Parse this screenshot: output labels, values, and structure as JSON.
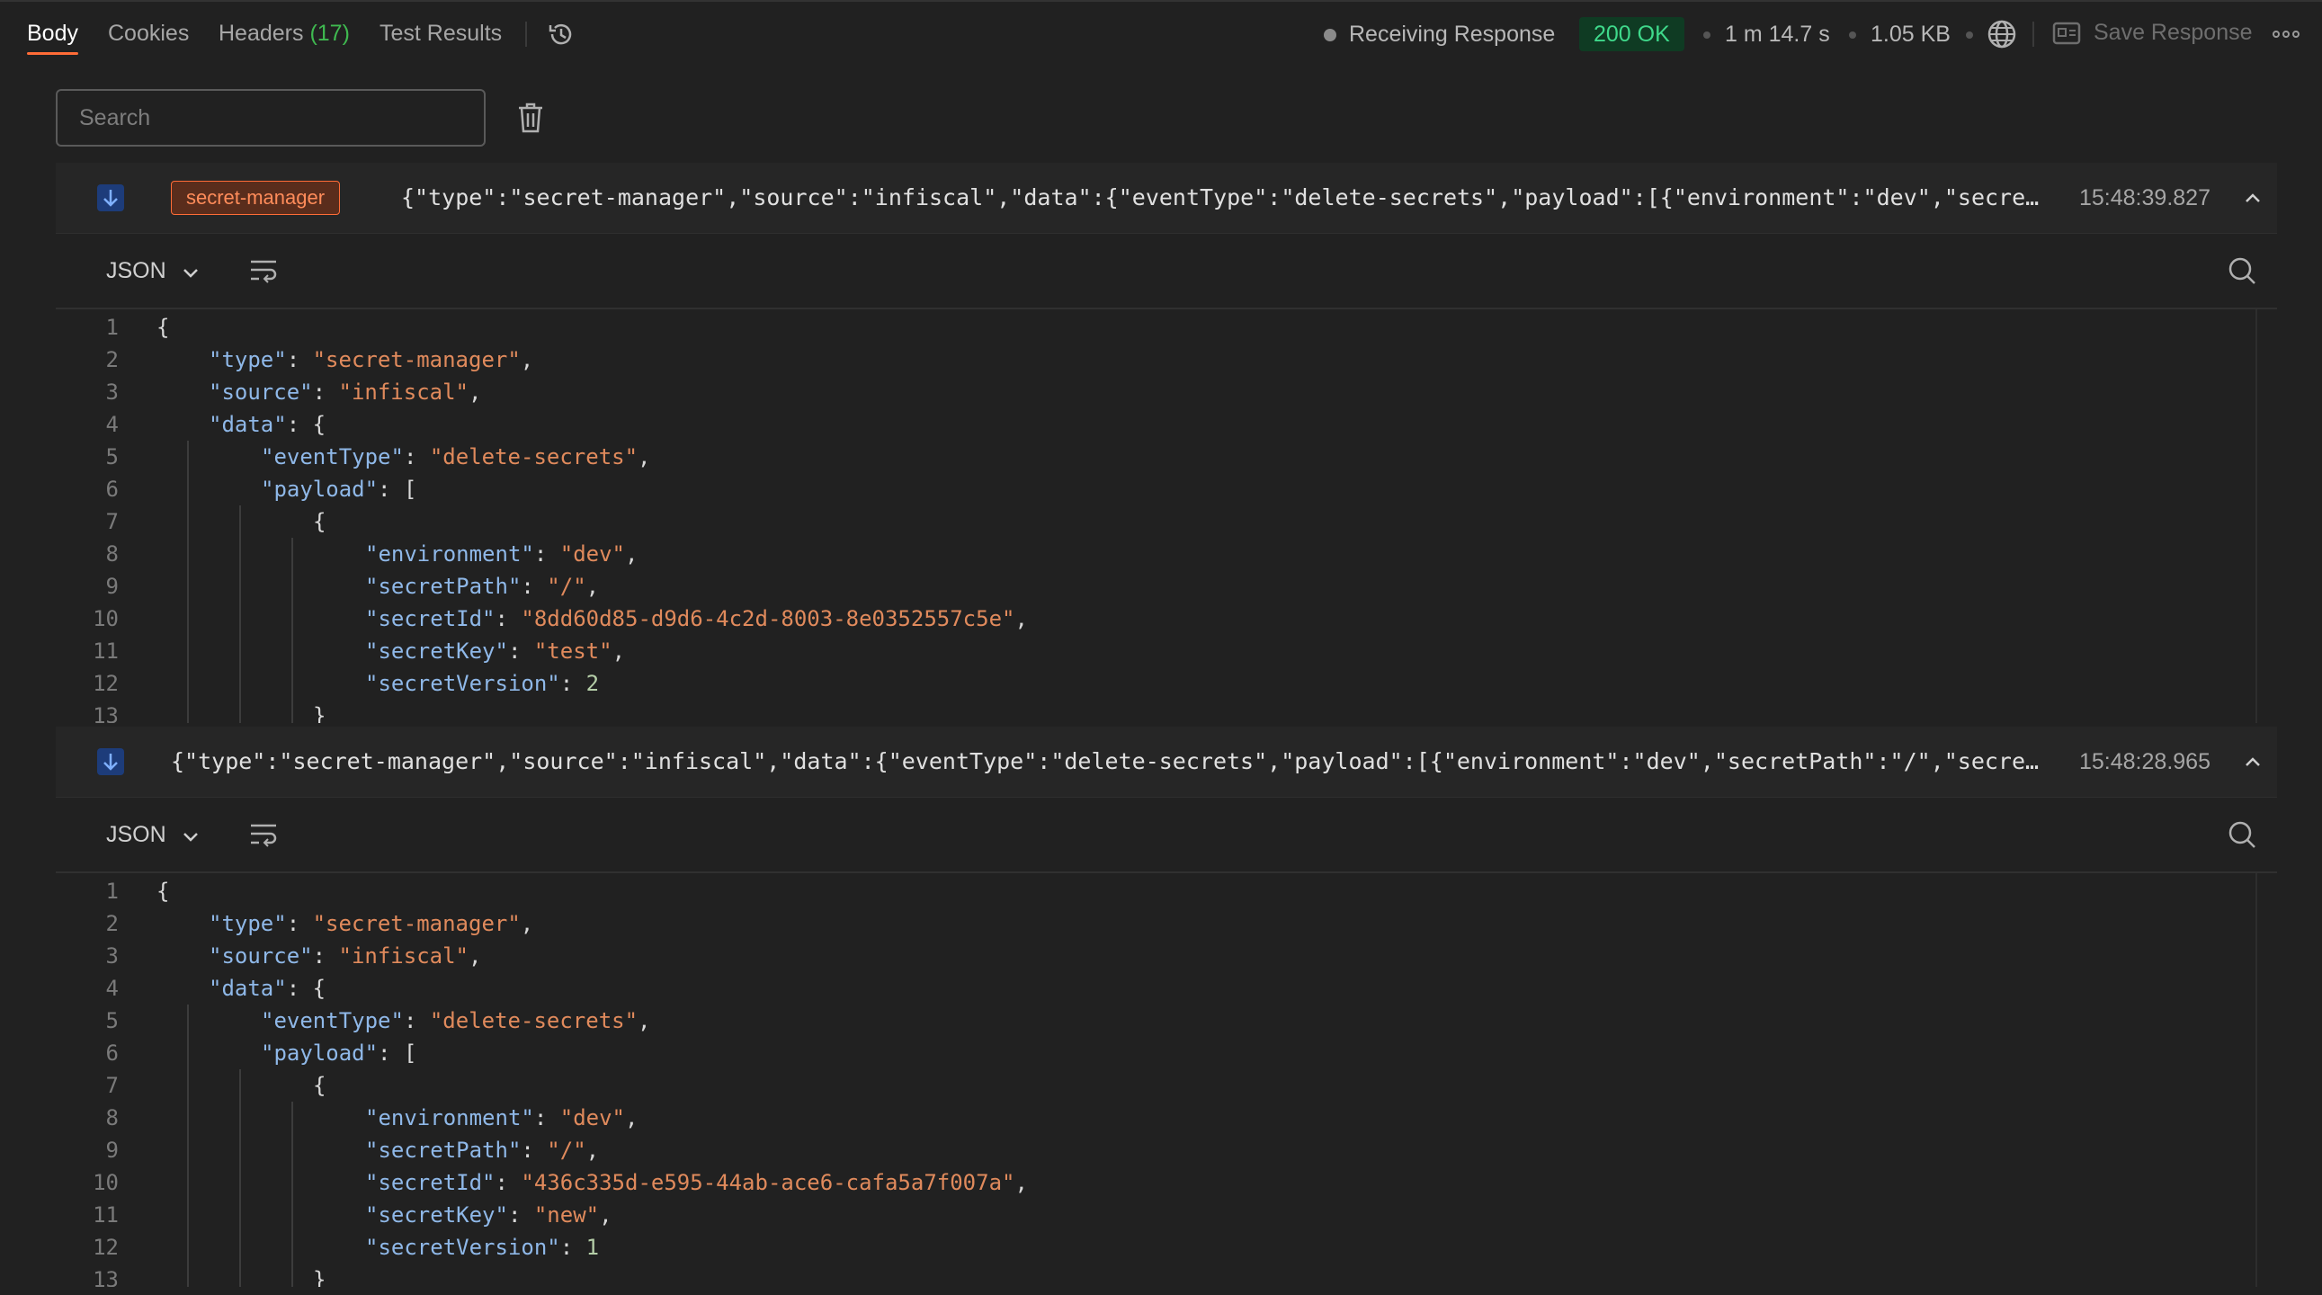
{
  "tabs": [
    {
      "label": "Body",
      "active": true
    },
    {
      "label": "Cookies"
    },
    {
      "label": "Headers",
      "count": "(17)"
    },
    {
      "label": "Test Results"
    }
  ],
  "status": {
    "receiving": "Receiving Response",
    "code": "200 OK",
    "time": "1 m 14.7 s",
    "size": "1.05 KB",
    "save_label": "Save Response"
  },
  "search": {
    "placeholder": "Search"
  },
  "messages": [
    {
      "tag": "secret-manager",
      "summary": "{\"type\":\"secret-manager\",\"source\":\"infiscal\",\"data\":{\"eventType\":\"delete-secrets\",\"payload\":[{\"environment\":\"dev\",\"secretPat…",
      "time": "15:48:39.827",
      "format": "JSON",
      "lines": [
        {
          "n": "1",
          "text": "{"
        },
        {
          "n": "2",
          "key": "\"type\"",
          "val": "\"secret-manager\"",
          "end": ","
        },
        {
          "n": "3",
          "key": "\"source\"",
          "val": "\"infiscal\"",
          "end": ","
        },
        {
          "n": "4",
          "key": "\"data\"",
          "rest": ": {"
        },
        {
          "n": "5",
          "key": "\"eventType\"",
          "val": "\"delete-secrets\"",
          "end": ","
        },
        {
          "n": "6",
          "key": "\"payload\"",
          "rest": ": ["
        },
        {
          "n": "7",
          "text": "{"
        },
        {
          "n": "8",
          "key": "\"environment\"",
          "val": "\"dev\"",
          "end": ","
        },
        {
          "n": "9",
          "key": "\"secretPath\"",
          "val": "\"/\"",
          "end": ","
        },
        {
          "n": "10",
          "key": "\"secretId\"",
          "val": "\"8dd60d85-d9d6-4c2d-8003-8e0352557c5e\"",
          "end": ","
        },
        {
          "n": "11",
          "key": "\"secretKey\"",
          "val": "\"test\"",
          "end": ","
        },
        {
          "n": "12",
          "key": "\"secretVersion\"",
          "num": "2",
          "end": ""
        },
        {
          "n": "13",
          "text": "}"
        }
      ]
    },
    {
      "tag": "",
      "summary": "{\"type\":\"secret-manager\",\"source\":\"infiscal\",\"data\":{\"eventType\":\"delete-secrets\",\"payload\":[{\"environment\":\"dev\",\"secretPath\":\"/\",\"secretId\":…",
      "time": "15:48:28.965",
      "format": "JSON",
      "lines": [
        {
          "n": "1",
          "text": "{"
        },
        {
          "n": "2",
          "key": "\"type\"",
          "val": "\"secret-manager\"",
          "end": ","
        },
        {
          "n": "3",
          "key": "\"source\"",
          "val": "\"infiscal\"",
          "end": ","
        },
        {
          "n": "4",
          "key": "\"data\"",
          "rest": ": {"
        },
        {
          "n": "5",
          "key": "\"eventType\"",
          "val": "\"delete-secrets\"",
          "end": ","
        },
        {
          "n": "6",
          "key": "\"payload\"",
          "rest": ": ["
        },
        {
          "n": "7",
          "text": "{"
        },
        {
          "n": "8",
          "key": "\"environment\"",
          "val": "\"dev\"",
          "end": ","
        },
        {
          "n": "9",
          "key": "\"secretPath\"",
          "val": "\"/\"",
          "end": ","
        },
        {
          "n": "10",
          "key": "\"secretId\"",
          "val": "\"436c335d-e595-44ab-ace6-cafa5a7f007a\"",
          "end": ","
        },
        {
          "n": "11",
          "key": "\"secretKey\"",
          "val": "\"new\"",
          "end": ","
        },
        {
          "n": "12",
          "key": "\"secretVersion\"",
          "num": "1",
          "end": ""
        },
        {
          "n": "13",
          "text": "}"
        }
      ]
    }
  ],
  "colors": {
    "accent": "#ff6c37",
    "status_ok_bg": "#0f3b23",
    "status_ok_text": "#3fd98b",
    "json_key": "#8fb8e8",
    "json_string": "#e08a5c"
  },
  "icons": [
    "history-icon",
    "globe-icon",
    "save-icon",
    "more-icon",
    "trash-icon",
    "arrow-down-icon",
    "chevron-up-icon",
    "chevron-down-icon",
    "wrap-icon",
    "search-icon"
  ]
}
